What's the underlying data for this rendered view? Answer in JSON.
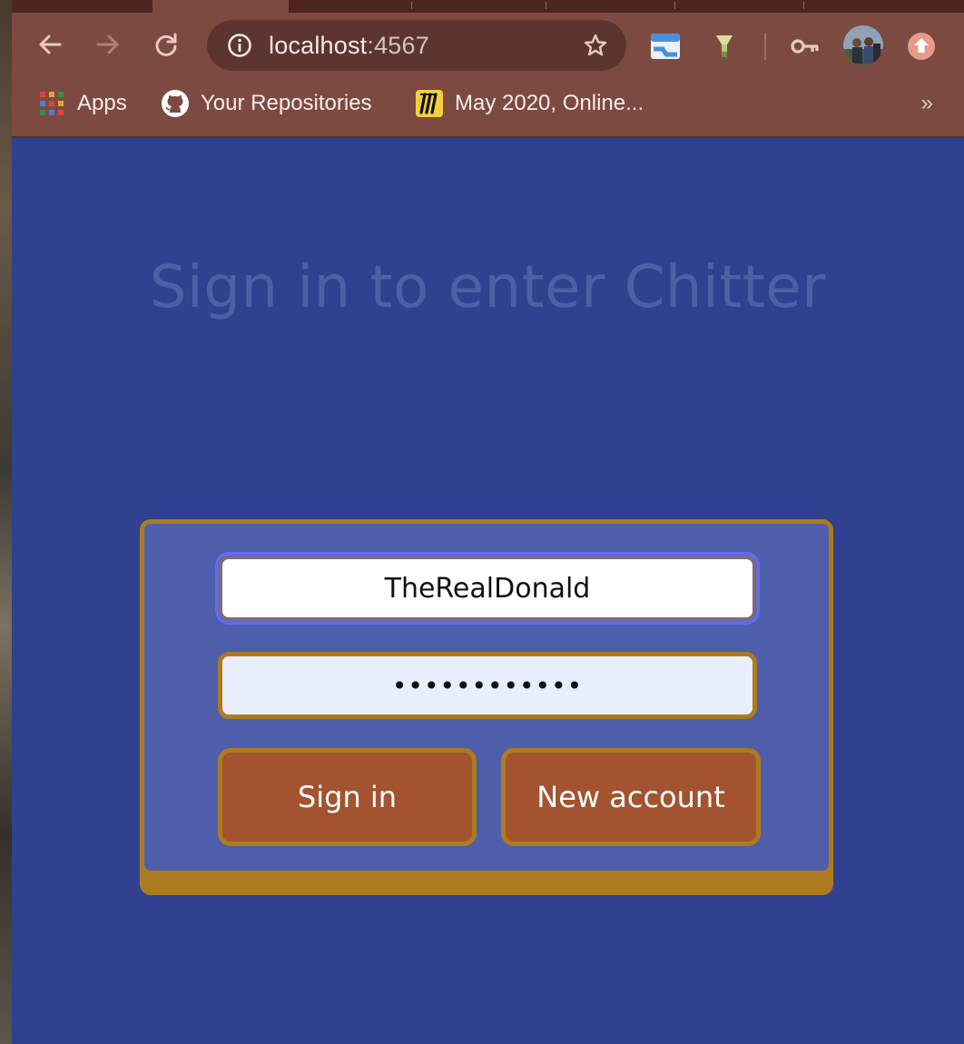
{
  "browser": {
    "url_host": "localhost",
    "url_port": ":4567",
    "bookmarks": [
      {
        "label": "Apps",
        "icon": "apps-grid-icon"
      },
      {
        "label": "Your Repositories",
        "icon": "github-icon"
      },
      {
        "label": "May 2020, Online...",
        "icon": "miro-icon"
      }
    ],
    "bookmarks_more": "»"
  },
  "page": {
    "title": "Sign in to enter Chitter",
    "username_value": "TheRealDonald",
    "password_value": "••••••••••••",
    "sign_in_label": "Sign in",
    "new_account_label": "New account"
  },
  "colors": {
    "page_background": "#30418f",
    "card_background": "#4f5eab",
    "card_border": "#ad7b1f",
    "button_background": "#a3532f",
    "browser_chrome": "#7d4a42"
  }
}
